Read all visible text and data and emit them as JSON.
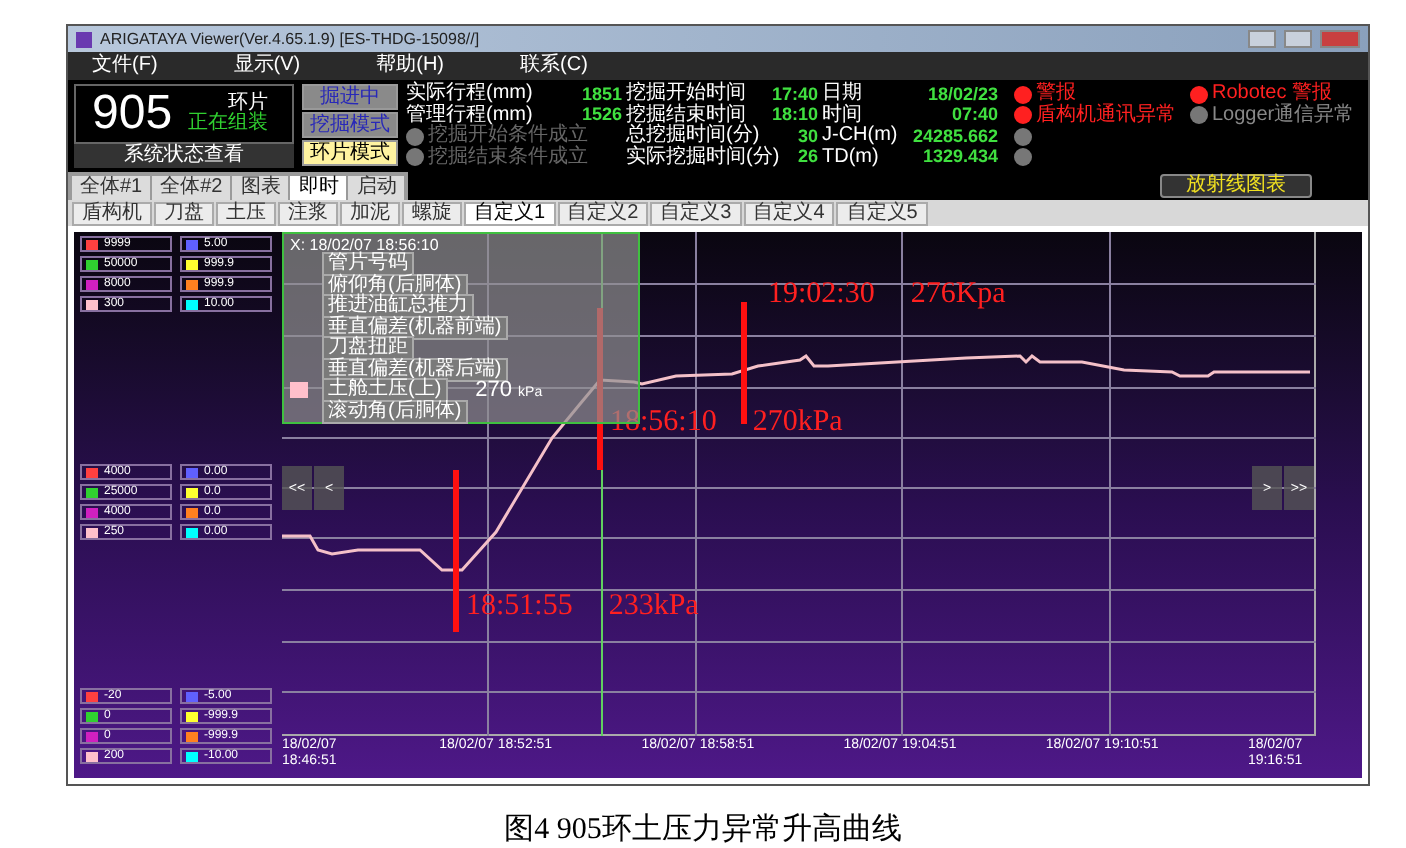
{
  "window": {
    "title": "ARIGATAYA Viewer(Ver.4.65.1.9) [ES-THDG-15098//]"
  },
  "menu": [
    "文件(F)",
    "显示(V)",
    "帮助(H)",
    "联系(C)"
  ],
  "ring_panel": {
    "number": "905",
    "label": "环片",
    "status": "正在组装",
    "button": "系统状态查看"
  },
  "mode_buttons": [
    {
      "label": "掘进中",
      "selected": false
    },
    {
      "label": "挖掘模式",
      "selected": false
    },
    {
      "label": "环片模式",
      "selected": true
    }
  ],
  "stats": [
    {
      "kind": "text",
      "cells": [
        {
          "label": "实际行程(mm)",
          "value": "1851"
        },
        {
          "label": "挖掘开始时间",
          "value": "17:40"
        },
        {
          "label": "日期",
          "value": "18/02/23"
        }
      ]
    },
    {
      "kind": "text",
      "cells": [
        {
          "label": "管理行程(mm)",
          "value": "1526"
        },
        {
          "label": "挖掘结束时间",
          "value": "18:10"
        },
        {
          "label": "时间",
          "value": "07:40"
        }
      ]
    },
    {
      "kind": "lamp",
      "on": false,
      "cells": [
        {
          "label": "挖掘开始条件成立"
        },
        {
          "label": "总挖掘时间(分)",
          "value": "30"
        },
        {
          "label": "J-CH(m)",
          "value": "24285.662"
        }
      ]
    },
    {
      "kind": "lamp",
      "on": false,
      "cells": [
        {
          "label": "挖掘结束条件成立"
        },
        {
          "label": "实际挖掘时间(分)",
          "value": "26"
        },
        {
          "label": "TD(m)",
          "value": "1329.434"
        }
      ]
    }
  ],
  "alarms": [
    {
      "label": "警报",
      "on": true
    },
    {
      "label": "盾构机通讯异常",
      "on": true
    },
    {
      "on": false
    },
    {
      "on": false
    }
  ],
  "alarms_right": [
    {
      "label": "Robotec 警报",
      "on": true
    },
    {
      "label": "Logger通信异常",
      "on": false
    }
  ],
  "tabs": [
    {
      "label": "全体#1",
      "selected": false
    },
    {
      "label": "全体#2",
      "selected": false
    },
    {
      "label": "图表",
      "selected": false
    },
    {
      "label": "即时",
      "selected": true
    },
    {
      "label": "启动",
      "selected": false
    }
  ],
  "radiation_button": "放射线图表",
  "subtabs": [
    {
      "label": "盾构机",
      "selected": false
    },
    {
      "label": "刀盘",
      "selected": false
    },
    {
      "label": "土压",
      "selected": false
    },
    {
      "label": "注浆",
      "selected": false
    },
    {
      "label": "加泥",
      "selected": false
    },
    {
      "label": "螺旋",
      "selected": false
    },
    {
      "label": "自定义1",
      "selected": true
    },
    {
      "label": "自定义2",
      "selected": false
    },
    {
      "label": "自定义3",
      "selected": false
    },
    {
      "label": "自定义4",
      "selected": false
    },
    {
      "label": "自定义5",
      "selected": false
    }
  ],
  "legend": [
    {
      "rows": [
        {
          "left": {
            "color": "#ff4040",
            "value": "9999"
          },
          "right": {
            "color": "#6060ff",
            "value": "5.00"
          }
        },
        {
          "left": {
            "color": "#30d030",
            "value": "50000"
          },
          "right": {
            "color": "#ffff30",
            "value": "999.9"
          }
        },
        {
          "left": {
            "color": "#d020c0",
            "value": "8000"
          },
          "right": {
            "color": "#ff8020",
            "value": "999.9"
          }
        },
        {
          "left": {
            "color": "#ffc0cb",
            "value": "300"
          },
          "right": {
            "color": "#00ffff",
            "value": "10.00"
          }
        }
      ]
    },
    {
      "rows": [
        {
          "left": {
            "color": "#ff4040",
            "value": "4000"
          },
          "right": {
            "color": "#6060ff",
            "value": "0.00"
          }
        },
        {
          "left": {
            "color": "#30d030",
            "value": "25000"
          },
          "right": {
            "color": "#ffff30",
            "value": "0.0"
          }
        },
        {
          "left": {
            "color": "#d020c0",
            "value": "4000"
          },
          "right": {
            "color": "#ff8020",
            "value": "0.0"
          }
        },
        {
          "left": {
            "color": "#ffc0cb",
            "value": "250"
          },
          "right": {
            "color": "#00ffff",
            "value": "0.00"
          }
        }
      ]
    },
    {
      "rows": [
        {
          "left": {
            "color": "#ff4040",
            "value": "-20"
          },
          "right": {
            "color": "#6060ff",
            "value": "-5.00"
          }
        },
        {
          "left": {
            "color": "#30d030",
            "value": "0"
          },
          "right": {
            "color": "#ffff30",
            "value": "-999.9"
          }
        },
        {
          "left": {
            "color": "#d020c0",
            "value": "0"
          },
          "right": {
            "color": "#ff8020",
            "value": "-999.9"
          }
        },
        {
          "left": {
            "color": "#ffc0cb",
            "value": "200"
          },
          "right": {
            "color": "#00ffff",
            "value": "-10.00"
          }
        }
      ]
    }
  ],
  "tooltip": {
    "time": "X: 18/02/07 18:56:10",
    "items": [
      {
        "label": "管片号码"
      },
      {
        "label": "俯仰角(后胴体)"
      },
      {
        "label": "推进油缸总推力"
      },
      {
        "label": "垂直偏差(机器前端)"
      },
      {
        "label": "刀盘扭距"
      },
      {
        "label": "垂直偏差(机器后端)"
      },
      {
        "label": "土舱土压(上)",
        "color": "#ffc0cb"
      },
      {
        "label": "滚动角(后胴体)"
      }
    ],
    "reading": "270",
    "unit": "kPa"
  },
  "nav_left": [
    "<<",
    "<"
  ],
  "nav_right": [
    ">",
    ">>"
  ],
  "annotations": [
    {
      "time": "19:02:30",
      "value": "276Kpa"
    },
    {
      "time": "18:56:10",
      "value": "270kPa"
    },
    {
      "time": "18:51:55",
      "value": "233kPa"
    }
  ],
  "x_labels": [
    "18/02/07 18:46:51",
    "18/02/07 18:52:51",
    "18/02/07 18:58:51",
    "18/02/07 19:04:51",
    "18/02/07 19:10:51",
    "18/02/07 19:16:51"
  ],
  "caption": "图4 905环土压力异常升高曲线"
}
